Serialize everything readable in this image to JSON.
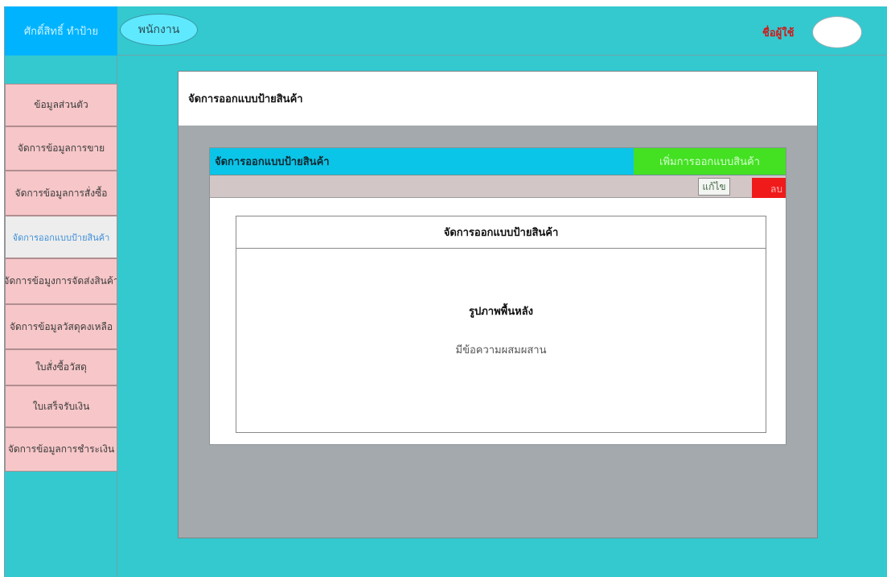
{
  "header": {
    "brand": "ศักดิ์สิทธิ์ ทำป้าย",
    "role": "พนักงาน",
    "username": "ชื่อผู้ใช้"
  },
  "sidebar": {
    "items": [
      {
        "label": "ข้อมูลส่วนตัว",
        "active": false
      },
      {
        "label": "จัดการข้อมูลการขาย",
        "active": false
      },
      {
        "label": "จัดการข้อมูลการสั่งซื้อ",
        "active": false
      },
      {
        "label": "จัดการออกแบบป้ายสินค้า",
        "active": true
      },
      {
        "label": "จัดการข้อมูงการจัดส่งสินค้า",
        "active": false
      },
      {
        "label": "จัดการข้อมูลวัสดุคงเหลือ",
        "active": false
      },
      {
        "label": "ใบสั่งซื้อวัสดุ",
        "active": false
      },
      {
        "label": "ใบเสร็จรับเงิน",
        "active": false
      },
      {
        "label": "จัดการข้อมูลการชำระเงิน",
        "active": false
      }
    ]
  },
  "main": {
    "page_title": "จัดการออกแบบป้ายสินค้า",
    "section_title": "จัดการออกแบบป้ายสินค้า",
    "add_button": "เพิ่มการออกแบบสินค้า",
    "edit_button": "แก้ไข",
    "delete_button": "ลบ",
    "card": {
      "title": "จัดการออกแบบป้ายสินค้า",
      "background_label": "รูปภาพพื้นหลัง",
      "mixed_text_label": "มีข้อความผสมผสาน"
    }
  },
  "colors": {
    "frame": "#33c9cf",
    "brand": "#00b3ff",
    "menu_item": "#f6c6c8",
    "add_button": "#44e022",
    "delete_button": "#f01a1a"
  }
}
